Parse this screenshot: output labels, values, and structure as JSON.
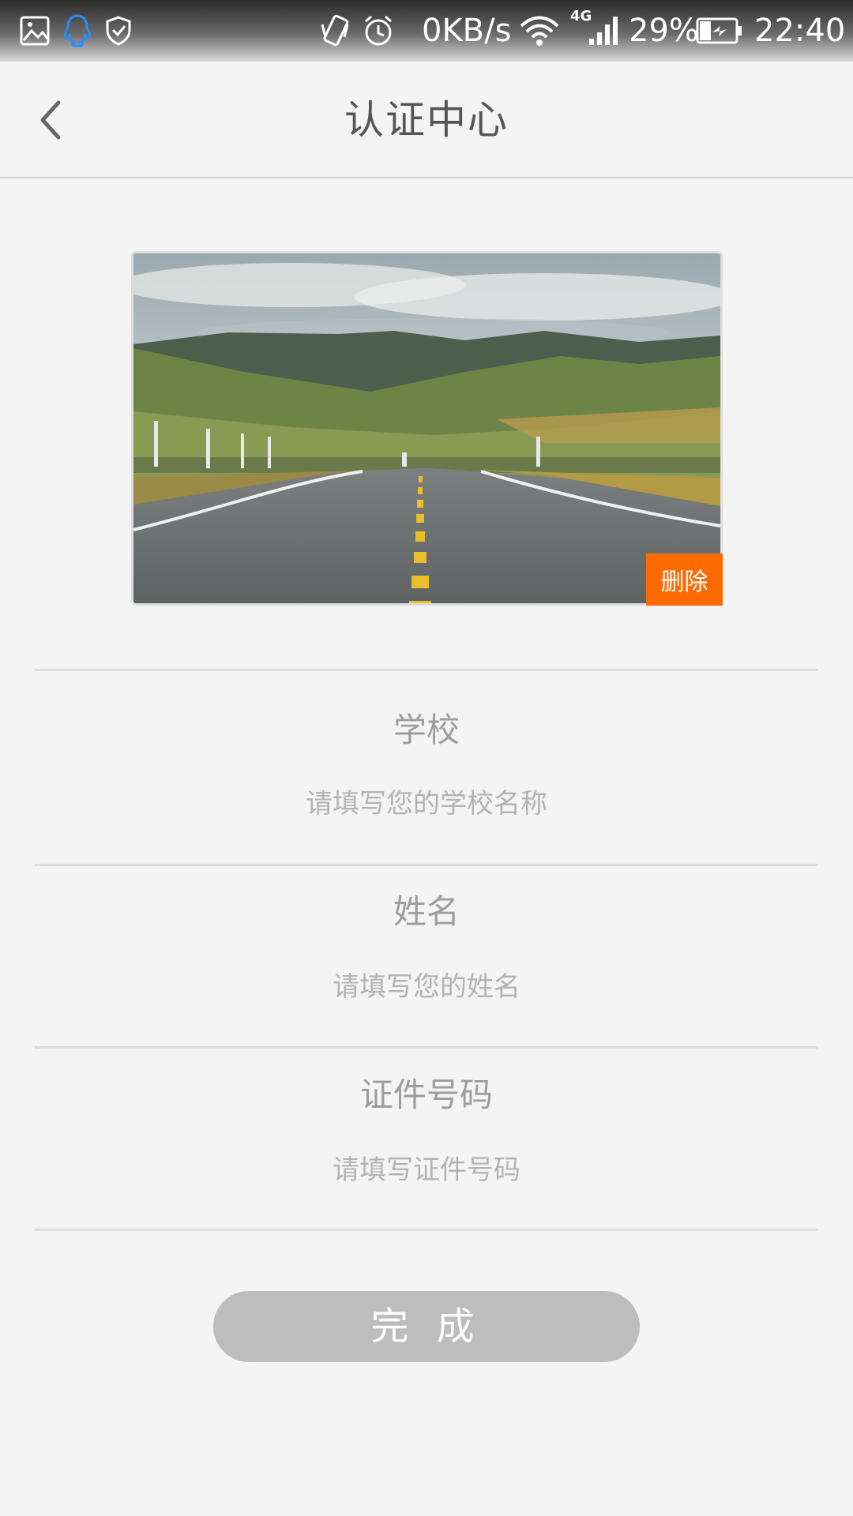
{
  "status_bar": {
    "net_speed": "0KB/s",
    "network_type": "4G",
    "battery": "29%",
    "time": "22:40",
    "icons": [
      "image-icon",
      "qq-icon",
      "shield-icon",
      "vibrate-icon",
      "alarm-icon",
      "wifi-icon",
      "signal-icon",
      "battery-charging-icon"
    ]
  },
  "header": {
    "title": "认证中心",
    "back_icon": "chevron-left-icon"
  },
  "photo": {
    "delete_label": "删除"
  },
  "form": {
    "school": {
      "label": "学校",
      "placeholder": "请填写您的学校名称",
      "value": ""
    },
    "name": {
      "label": "姓名",
      "placeholder": "请填写您的姓名",
      "value": ""
    },
    "id_number": {
      "label": "证件号码",
      "placeholder": "请填写证件号码",
      "value": ""
    }
  },
  "submit_label": "完 成",
  "colors": {
    "accent": "#ff6a00",
    "button_disabled": "#bdbdbd",
    "background": "#f4f4f4"
  }
}
